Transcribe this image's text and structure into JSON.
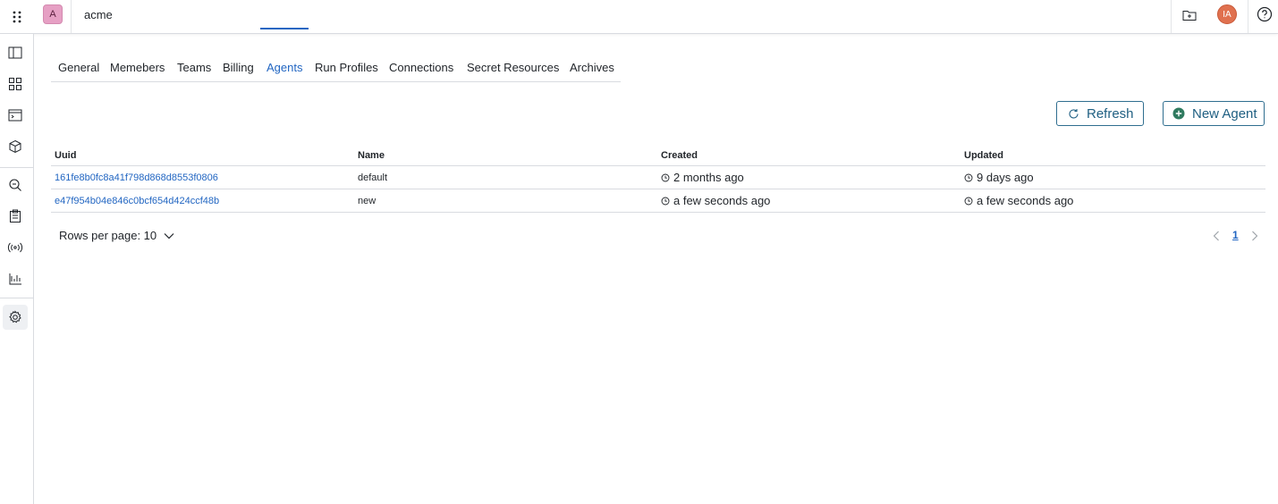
{
  "topbar": {
    "org_initial": "A",
    "org_name": "acme",
    "user_initials": "IA",
    "icons": [
      "app-grid-icon",
      "folder-icon",
      "help-icon"
    ]
  },
  "sidebar": {
    "items": [
      {
        "icon": "book-icon"
      },
      {
        "icon": "dashboard-icon"
      },
      {
        "icon": "terminal-window-icon"
      },
      {
        "icon": "package-icon"
      },
      {
        "icon": "search-icon"
      },
      {
        "icon": "clipboard-icon"
      },
      {
        "icon": "broadcast-icon"
      },
      {
        "icon": "chart-icon"
      },
      {
        "icon": "gear-icon",
        "active": true
      }
    ]
  },
  "tabs": [
    {
      "label": "General"
    },
    {
      "label": "Memebers"
    },
    {
      "label": "Teams"
    },
    {
      "label": "Billing"
    },
    {
      "label": "Agents",
      "active": true
    },
    {
      "label": "Run Profiles"
    },
    {
      "label": "Connections"
    },
    {
      "label": "Secret Resources"
    },
    {
      "label": "Archives"
    }
  ],
  "actions": {
    "refresh_label": "Refresh",
    "new_label": "New Agent"
  },
  "table": {
    "headers": {
      "uuid": "Uuid",
      "name": "Name",
      "created": "Created",
      "updated": "Updated"
    },
    "rows": [
      {
        "uuid": "161fe8b0fc8a41f798d868d8553f0806",
        "name": "default",
        "created": "2 months ago",
        "updated": "9 days ago"
      },
      {
        "uuid": "e47f954b04e846c0bcf654d424ccf48b",
        "name": "new",
        "created": "a few seconds ago",
        "updated": "a few seconds ago"
      }
    ]
  },
  "pagination": {
    "rows_per_page_label": "Rows per page: 10",
    "current_page": "1"
  },
  "colors": {
    "accent": "#2266c2",
    "button_border": "#2f6e8f",
    "add_icon": "#2f7a5f",
    "org_avatar": "#e6a0c4",
    "user_avatar": "#e0714f"
  }
}
